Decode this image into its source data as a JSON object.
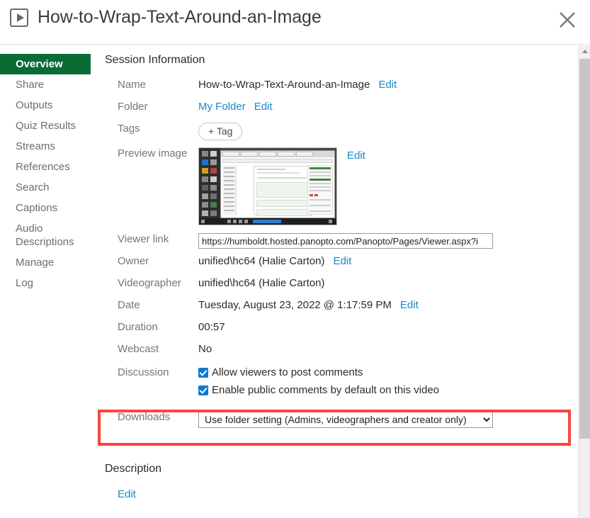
{
  "header": {
    "title": "How-to-Wrap-Text-Around-an-Image",
    "play_icon": "play-icon",
    "close_icon": "close-icon"
  },
  "sidebar": {
    "items": [
      {
        "label": "Overview",
        "active": true
      },
      {
        "label": "Share",
        "active": false
      },
      {
        "label": "Outputs",
        "active": false
      },
      {
        "label": "Quiz Results",
        "active": false
      },
      {
        "label": "Streams",
        "active": false
      },
      {
        "label": "References",
        "active": false
      },
      {
        "label": "Search",
        "active": false
      },
      {
        "label": "Captions",
        "active": false
      },
      {
        "label": "Audio Descriptions",
        "active": false
      },
      {
        "label": "Manage",
        "active": false
      },
      {
        "label": "Log",
        "active": false
      }
    ]
  },
  "main": {
    "section_title": "Session Information",
    "rows": {
      "name": {
        "label": "Name",
        "value": "How-to-Wrap-Text-Around-an-Image",
        "edit": "Edit"
      },
      "folder": {
        "label": "Folder",
        "value": "My Folder",
        "edit": "Edit"
      },
      "tags": {
        "label": "Tags",
        "add_tag": "+ Tag"
      },
      "preview_image": {
        "label": "Preview image",
        "edit": "Edit"
      },
      "viewer_link": {
        "label": "Viewer link",
        "value": "https://humboldt.hosted.panopto.com/Panopto/Pages/Viewer.aspx?i"
      },
      "owner": {
        "label": "Owner",
        "value": "unified\\hc64 (Halie Carton)",
        "edit": "Edit"
      },
      "videographer": {
        "label": "Videographer",
        "value": "unified\\hc64 (Halie Carton)"
      },
      "date": {
        "label": "Date",
        "value": "Tuesday, August 23, 2022 @ 1:17:59 PM",
        "edit": "Edit"
      },
      "duration": {
        "label": "Duration",
        "value": "00:57"
      },
      "webcast": {
        "label": "Webcast",
        "value": "No"
      },
      "discussion": {
        "label": "Discussion",
        "checkbox_1": "Allow viewers to post comments",
        "checkbox_2": "Enable public comments by default on this video"
      },
      "downloads": {
        "label": "Downloads",
        "selected": "Use folder setting (Admins, videographers and creator only)"
      }
    }
  },
  "description": {
    "title": "Description",
    "edit": "Edit"
  },
  "colors": {
    "accent_green": "#0b6b35",
    "link_blue": "#1b87c9",
    "checkbox_blue": "#0a7ad1",
    "highlight_red": "#f7463f"
  }
}
